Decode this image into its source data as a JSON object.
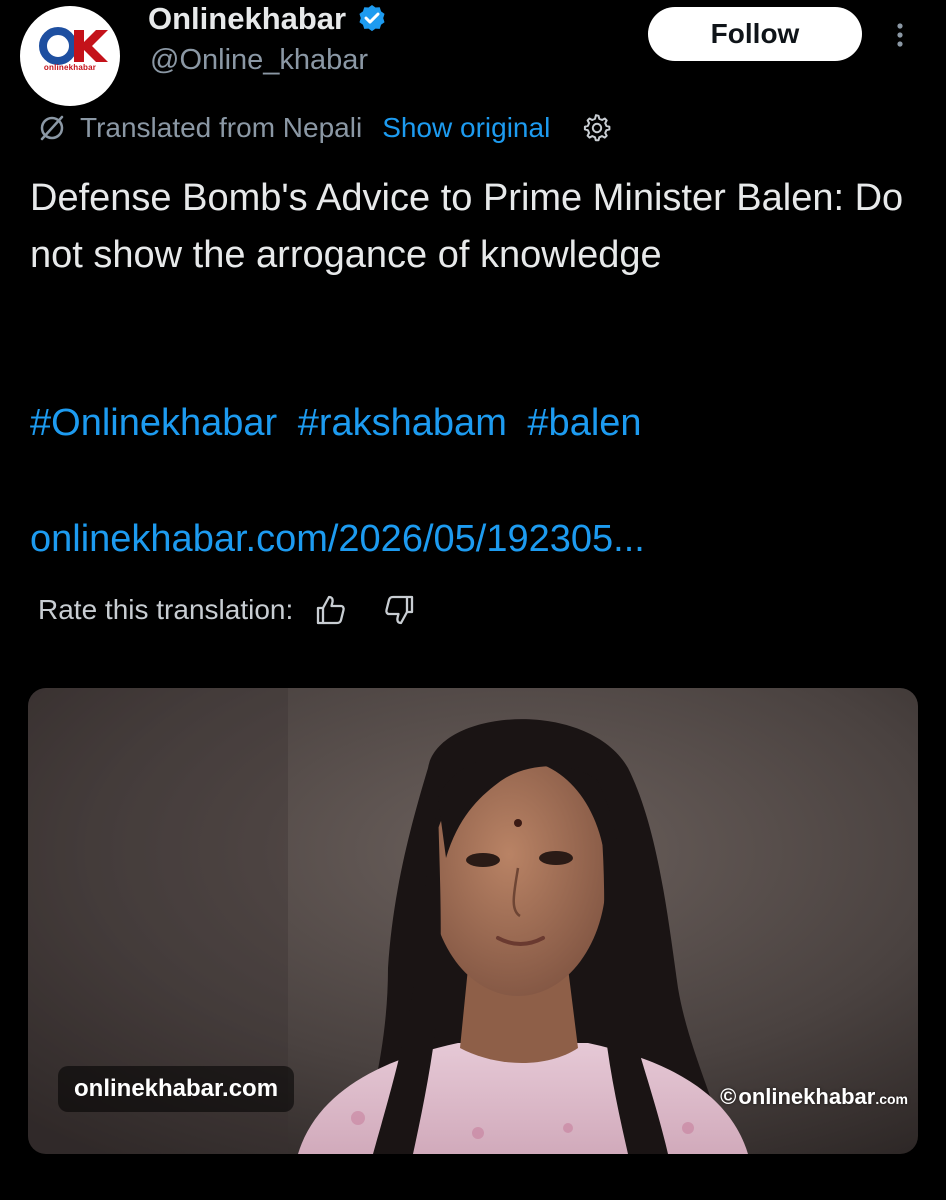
{
  "account": {
    "avatar_logo": "OK",
    "avatar_sub": "onlinekhabar",
    "display_name": "Onlinekhabar",
    "handle": "@Online_khabar",
    "verified": true
  },
  "actions": {
    "follow_label": "Follow",
    "more_icon": "more-vertical-icon"
  },
  "translation": {
    "note": "Translated from Nepali",
    "show_original": "Show original",
    "rate_label": "Rate this translation:"
  },
  "post": {
    "text": "Defense Bomb's Advice to Prime Minister Balen: Do not show the arrogance of knowledge",
    "hashtags": [
      "#Onlinekhabar",
      "#rakshabam",
      "#balen"
    ],
    "link": "onlinekhabar.com/2026/05/192305..."
  },
  "media": {
    "watermark_left": "onlinekhabar.com",
    "watermark_right_copy": "©",
    "watermark_right_name": "onlinekhabar",
    "watermark_right_tld": ".com"
  },
  "colors": {
    "background": "#000000",
    "text": "#e7e9ea",
    "muted": "#8b98a5",
    "link": "#1d9bf0",
    "brand_red": "#c4121a",
    "brand_blue": "#1e4fa0"
  }
}
